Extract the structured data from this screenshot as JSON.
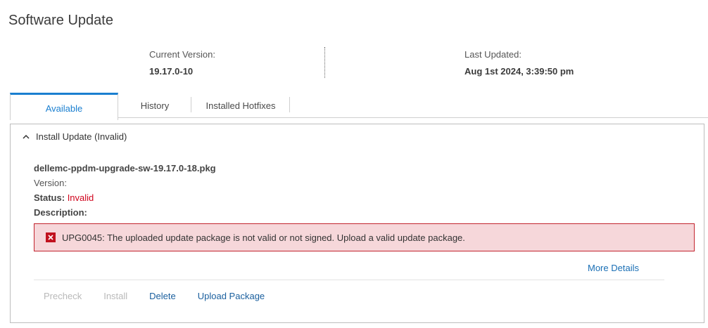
{
  "page": {
    "title": "Software Update"
  },
  "version_info": {
    "current_label": "Current Version:",
    "current_value": "19.17.0-10",
    "updated_label": "Last Updated:",
    "updated_value": "Aug 1st 2024, 3:39:50 pm"
  },
  "tabs": [
    {
      "label": "Available",
      "active": true
    },
    {
      "label": "History",
      "active": false
    },
    {
      "label": "Installed Hotfixes",
      "active": false
    }
  ],
  "panel": {
    "header": "Install Update (Invalid)",
    "package_name": "dellemc-ppdm-upgrade-sw-19.17.0-18.pkg",
    "version_label": "Version:",
    "status_label": "Status:",
    "status_value": "Invalid",
    "description_label": "Description:",
    "error_message": "UPG0045: The uploaded update package is not valid or not signed. Upload a valid update package.",
    "more_details": "More Details"
  },
  "actions": {
    "precheck": "Precheck",
    "install": "Install",
    "delete": "Delete",
    "upload": "Upload Package"
  },
  "colors": {
    "accent": "#1a7fd0",
    "link": "#1a5f9e",
    "error": "#d0021b",
    "error_bg": "#f6d7da"
  }
}
